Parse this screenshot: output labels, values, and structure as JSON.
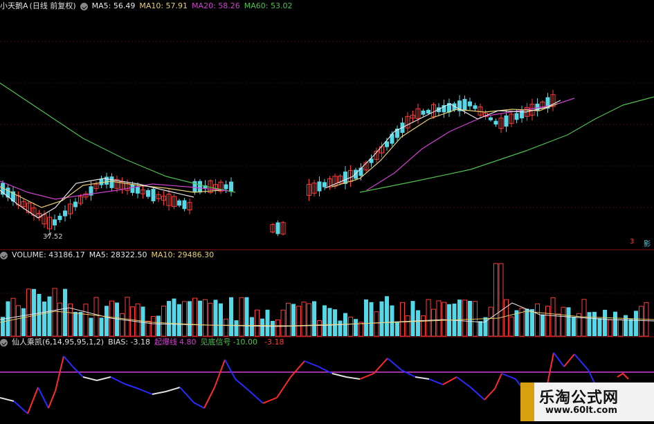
{
  "price_panel": {
    "stock_name": "小天鹅A",
    "adjust_mode": "(日线 前复权)",
    "ma5_label": "MA5: 56.49",
    "ma10_label": "MA10: 57.91",
    "ma20_label": "MA20: 58.26",
    "ma60_label": "MA60: 53.02",
    "low_annotation": "37.52",
    "marker_right_a": "3",
    "marker_right_b": "影"
  },
  "volume_panel": {
    "volume_label": "VOLUME: 43186.17",
    "ma5_label": "MA5: 28322.50",
    "ma10_label": "MA10: 29486.30"
  },
  "indicator_panel": {
    "name": "仙人乘凯(6,14,95,95,1,2)",
    "bias_label": "BIAS: -3.18",
    "qibao_label": "起爆线",
    "qibao_value": "4.80",
    "jiandi_label": "见底信号",
    "jiandi_value": "-10.00",
    "last_value": "-3.18"
  },
  "watermark": {
    "line1": "乐淘公式网",
    "line2": "www.60lt.com"
  },
  "colors": {
    "up": "#ff3b3b",
    "down": "#54d8e8",
    "ma5": "#e8e8e8",
    "ma10": "#e8d070",
    "ma20": "#d040d0",
    "ma60": "#50c050",
    "separator": "#8a1010",
    "qibao_line": "#d040d0",
    "bias_down": "#2a2aff",
    "bias_up": "#ff2a2a",
    "bias_flat": "#e0e0e0"
  },
  "chart_data": [
    {
      "type": "candlestick",
      "title": "小天鹅A (日线 前复权)",
      "ylim": [
        36,
        68
      ],
      "x": [
        0,
        1,
        2,
        3,
        4,
        5,
        6,
        7,
        8,
        9,
        10,
        11,
        12,
        13,
        14,
        15,
        15,
        16,
        17,
        18,
        19,
        20,
        21,
        22,
        23,
        24,
        25,
        26,
        27,
        28,
        29,
        30,
        31,
        32,
        33,
        34,
        35,
        36,
        37,
        38,
        39,
        40,
        41,
        42,
        43,
        44,
        45,
        46,
        47,
        48,
        49,
        50,
        51,
        52,
        53,
        54,
        55,
        56,
        57,
        58,
        59,
        60,
        61,
        62,
        63,
        64,
        65,
        66,
        67,
        68,
        69,
        70,
        71,
        72,
        73,
        74,
        75,
        76,
        77,
        78,
        79,
        80,
        81,
        82,
        83,
        84,
        85,
        86,
        87,
        88,
        89,
        90,
        91,
        92,
        93,
        94,
        95,
        96,
        97,
        98,
        99
      ],
      "ohlc": [],
      "note": ""
    }
  ]
}
